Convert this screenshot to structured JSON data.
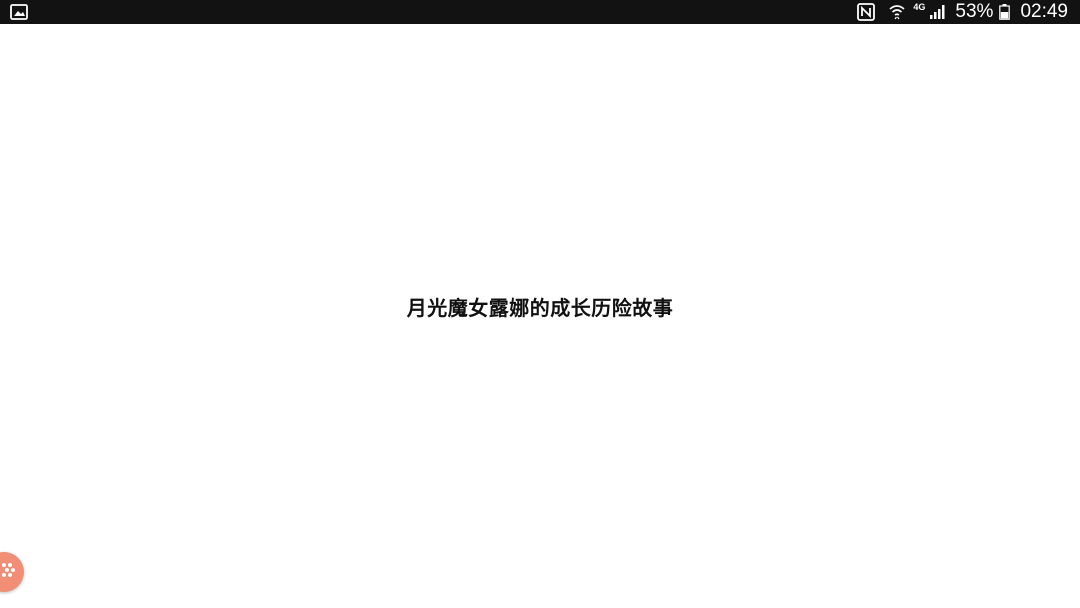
{
  "status_bar": {
    "network_type": "4G",
    "battery_percent": "53%",
    "time": "02:49",
    "icons": {
      "left": "gallery-icon",
      "nfc": "nfc-icon",
      "wifi": "wifi-icon",
      "signal": "signal-icon",
      "battery": "battery-icon"
    }
  },
  "content": {
    "title": "月光魔女露娜的成长历险故事"
  },
  "floating_button": {
    "icon": "dots-menu-icon",
    "color": "#f28d76"
  }
}
